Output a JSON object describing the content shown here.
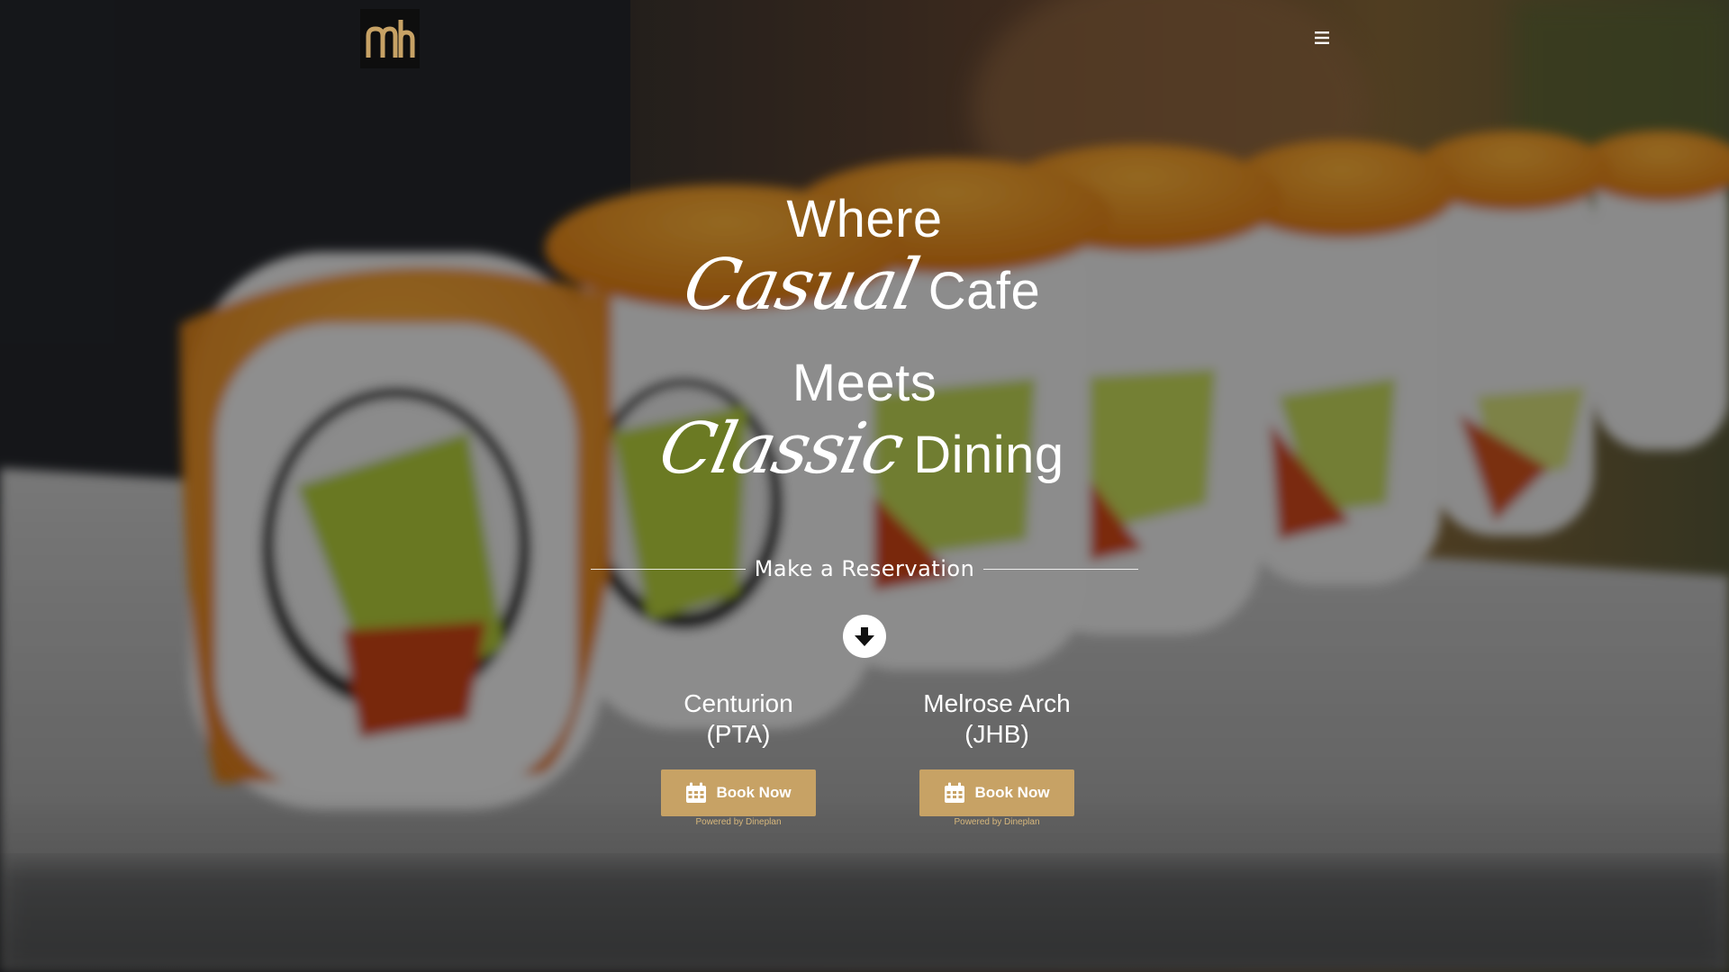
{
  "header": {
    "logo_icon": "mh-monogram-logo",
    "menu_icon": "hamburger-menu-icon"
  },
  "hero": {
    "line1": "Where",
    "line2_script": "Casual",
    "line2_rest": "Cafe",
    "line3": "Meets",
    "line4_script": "Classic",
    "line4_rest": "Dining"
  },
  "reservation": {
    "title": "Make a Reservation",
    "arrow_icon": "arrow-down-circle-icon",
    "locations": [
      {
        "name": "Centurion",
        "code": "(PTA)",
        "button_label": "Book Now",
        "button_icon": "calendar-icon",
        "powered_by": "Powered by Dineplan"
      },
      {
        "name": "Melrose Arch",
        "code": "(JHB)",
        "button_label": "Book Now",
        "button_icon": "calendar-icon",
        "powered_by": "Powered by Dineplan"
      }
    ]
  },
  "colors": {
    "accent_gold": "#c7a265",
    "text_white": "#ffffff",
    "overlay": "#000000"
  }
}
